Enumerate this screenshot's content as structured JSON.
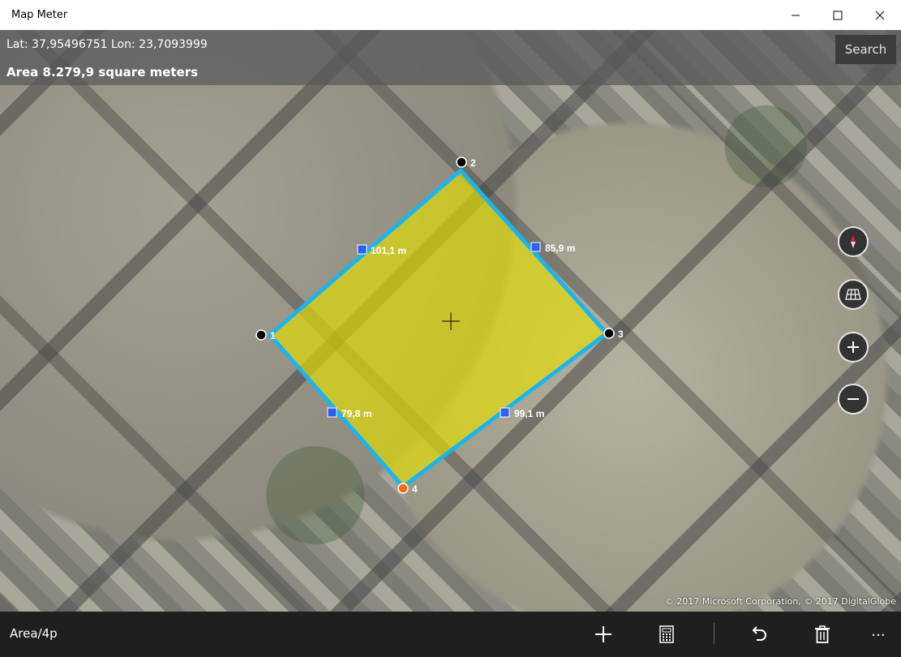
{
  "window": {
    "title": "Map Meter"
  },
  "info": {
    "latlon": "Lat: 37,95496751 Lon: 23,7093999",
    "area": "Area 8.279,9 square meters",
    "search_label": "Search"
  },
  "polygon": {
    "vertices": [
      {
        "label": "1"
      },
      {
        "label": "2"
      },
      {
        "label": "3"
      },
      {
        "label": "4"
      }
    ],
    "edges": [
      {
        "label": "101,1 m"
      },
      {
        "label": "85,9 m"
      },
      {
        "label": "99,1 m"
      },
      {
        "label": "79,8 m"
      }
    ],
    "fill_color": "#e6e000",
    "stroke_color": "#19b5f0"
  },
  "map_controls": [
    "compass-icon",
    "map-style-icon",
    "zoom-in-icon",
    "zoom-out-icon"
  ],
  "copyright": "© 2017 Microsoft Corporation, © 2017 DigitalGlobe",
  "bottombar": {
    "mode_label": "Area/4p",
    "icons": [
      "add-icon",
      "calculator-icon",
      "undo-icon",
      "delete-icon",
      "more-icon"
    ],
    "more_label": "..."
  }
}
